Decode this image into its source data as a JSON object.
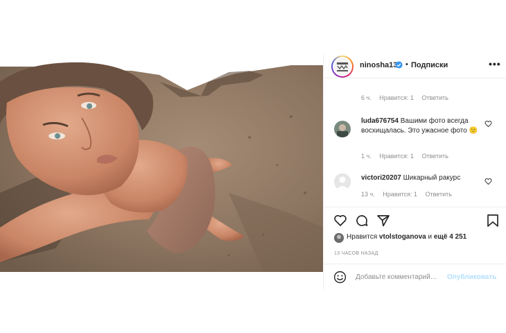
{
  "post": {
    "image_description_icon": "user-tag-icon",
    "author": "ninosha13",
    "dot": "•",
    "follow_label": "Подписки",
    "more_label": "•••"
  },
  "comments": [
    {
      "time": "6 ч.",
      "likes": "Нравится: 1",
      "reply": "Ответить"
    },
    {
      "username": "luda676754",
      "text": "Вашими фото всегда восхищалась. Это ужасное фото 😕",
      "time": "1 ч.",
      "likes": "Нравится: 1",
      "reply": "Ответить"
    },
    {
      "username": "victori20207",
      "text": "Шикарный ракурс",
      "time": "13 ч.",
      "likes": "Нравится: 1",
      "reply": "Ответить"
    }
  ],
  "likes": {
    "prefix": "Нравится",
    "user": "vtolstoganova",
    "middle": "и",
    "count": "ещё 4 251"
  },
  "time_ago": "13 ЧАСОВ НАЗАД",
  "comment_box": {
    "placeholder": "Добавьте комментарий…",
    "publish_label": "Опубликовать"
  },
  "colors": {
    "verified": "#3897f0",
    "publish": "#b2dffc",
    "meta": "#8e8e8e"
  }
}
